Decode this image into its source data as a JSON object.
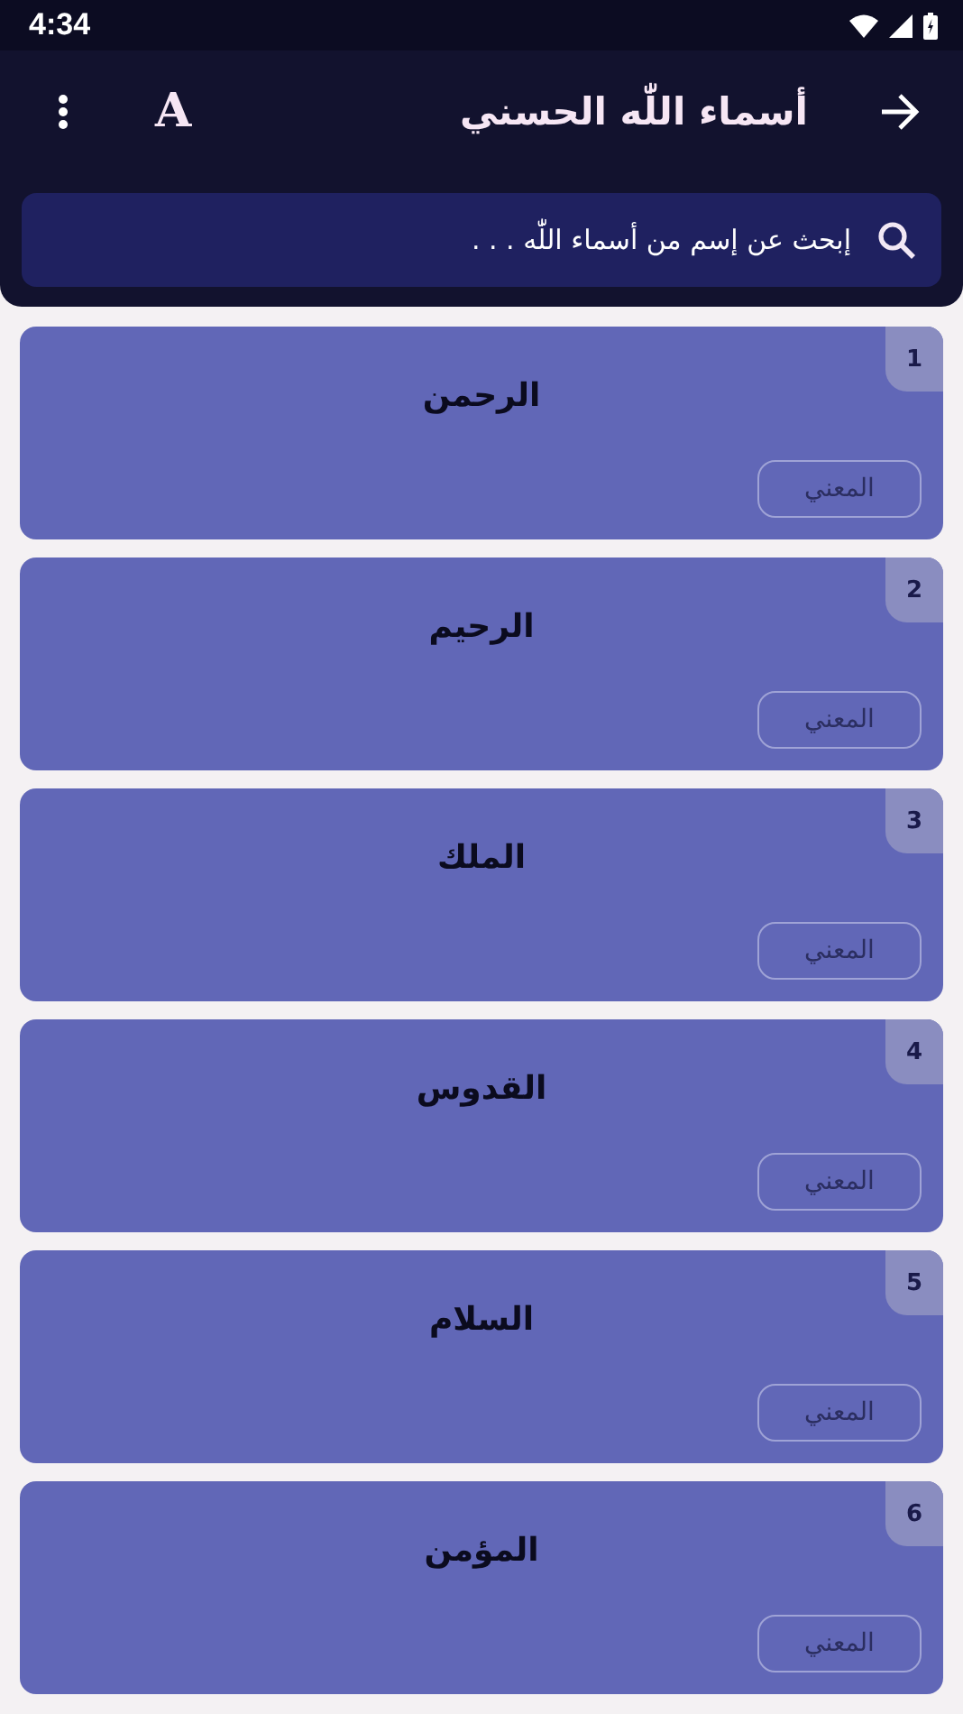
{
  "status_bar": {
    "time": "4:34"
  },
  "app_bar": {
    "title": "أسماء اللّٰه الحسني",
    "font_button": "A"
  },
  "search": {
    "placeholder": "إبحث عن إسم من أسماء اللّٰه . . ."
  },
  "names": [
    {
      "number": "1",
      "name": "الرحمن",
      "meaning_button": "المعني"
    },
    {
      "number": "2",
      "name": "الرحيم",
      "meaning_button": "المعني"
    },
    {
      "number": "3",
      "name": "الملك",
      "meaning_button": "المعني"
    },
    {
      "number": "4",
      "name": "القدوس",
      "meaning_button": "المعني"
    },
    {
      "number": "5",
      "name": "السلام",
      "meaning_button": "المعني"
    },
    {
      "number": "6",
      "name": "المؤمن",
      "meaning_button": "المعني"
    }
  ]
}
